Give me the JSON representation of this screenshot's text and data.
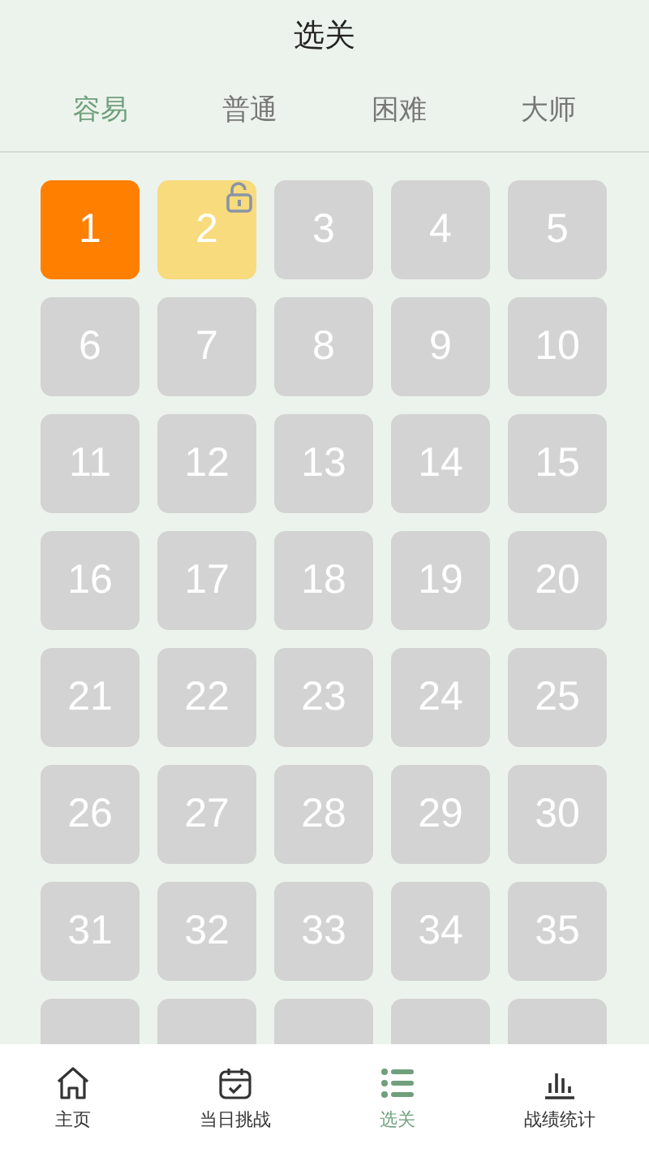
{
  "title": "选关",
  "tabs": [
    {
      "label": "容易",
      "selected": true
    },
    {
      "label": "普通",
      "selected": false
    },
    {
      "label": "困难",
      "selected": false
    },
    {
      "label": "大师",
      "selected": false
    }
  ],
  "levels": [
    {
      "label": "1",
      "kind": "current"
    },
    {
      "label": "2",
      "kind": "unlocked"
    },
    {
      "label": "3",
      "kind": "locked"
    },
    {
      "label": "4",
      "kind": "locked"
    },
    {
      "label": "5",
      "kind": "locked"
    },
    {
      "label": "6",
      "kind": "locked"
    },
    {
      "label": "7",
      "kind": "locked"
    },
    {
      "label": "8",
      "kind": "locked"
    },
    {
      "label": "9",
      "kind": "locked"
    },
    {
      "label": "10",
      "kind": "locked"
    },
    {
      "label": "11",
      "kind": "locked"
    },
    {
      "label": "12",
      "kind": "locked"
    },
    {
      "label": "13",
      "kind": "locked"
    },
    {
      "label": "14",
      "kind": "locked"
    },
    {
      "label": "15",
      "kind": "locked"
    },
    {
      "label": "16",
      "kind": "locked"
    },
    {
      "label": "17",
      "kind": "locked"
    },
    {
      "label": "18",
      "kind": "locked"
    },
    {
      "label": "19",
      "kind": "locked"
    },
    {
      "label": "20",
      "kind": "locked"
    },
    {
      "label": "21",
      "kind": "locked"
    },
    {
      "label": "22",
      "kind": "locked"
    },
    {
      "label": "23",
      "kind": "locked"
    },
    {
      "label": "24",
      "kind": "locked"
    },
    {
      "label": "25",
      "kind": "locked"
    },
    {
      "label": "26",
      "kind": "locked"
    },
    {
      "label": "27",
      "kind": "locked"
    },
    {
      "label": "28",
      "kind": "locked"
    },
    {
      "label": "29",
      "kind": "locked"
    },
    {
      "label": "30",
      "kind": "locked"
    },
    {
      "label": "31",
      "kind": "locked"
    },
    {
      "label": "32",
      "kind": "locked"
    },
    {
      "label": "33",
      "kind": "locked"
    },
    {
      "label": "34",
      "kind": "locked"
    },
    {
      "label": "35",
      "kind": "locked"
    },
    {
      "kind": "locked"
    },
    {
      "kind": "locked"
    },
    {
      "kind": "locked"
    },
    {
      "kind": "locked"
    },
    {
      "kind": "locked"
    }
  ],
  "nav": [
    {
      "label": "主页",
      "kind": "home",
      "selected": false
    },
    {
      "label": "当日挑战",
      "kind": "calendar",
      "selected": false
    },
    {
      "label": "选关",
      "kind": "list",
      "selected": true
    },
    {
      "label": "战绩统计",
      "kind": "chart",
      "selected": false
    }
  ]
}
